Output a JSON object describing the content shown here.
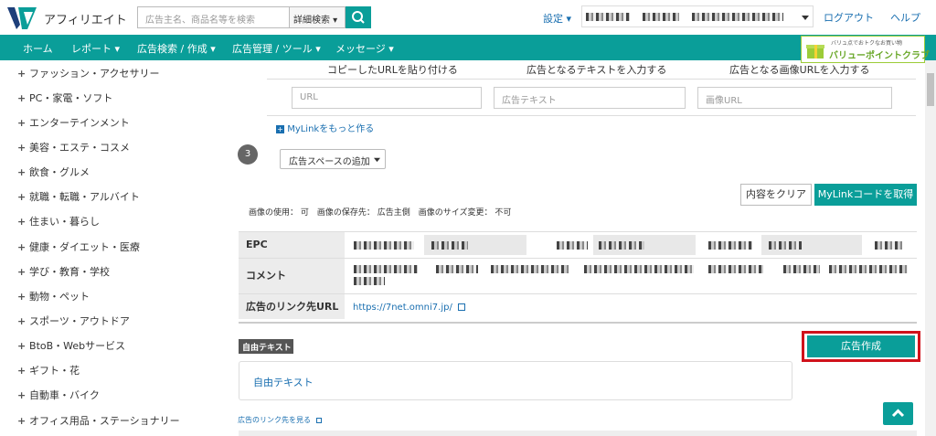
{
  "header": {
    "logo_text": "アフィリエイト",
    "search_placeholder": "広告主名、商品名等を検索",
    "detail_search_label": "詳細検索 ▾",
    "settings_label": "設定 ▾",
    "logout_label": "ログアウト",
    "help_label": "ヘルプ"
  },
  "nav": {
    "items": [
      "ホーム",
      "レポート ▾",
      "広告検索 / 作成 ▾",
      "広告管理 / ツール ▾",
      "メッセージ ▾"
    ],
    "banner_small": "バリュ点でおトクなお買い物",
    "banner_main": "バリューポイントクラブ"
  },
  "sidebar": {
    "items": [
      "ファッション・アクセサリー",
      "PC・家電・ソフト",
      "エンターテインメント",
      "美容・エステ・コスメ",
      "飲食・グルメ",
      "就職・転職・アルバイト",
      "住まい・暮らし",
      "健康・ダイエット・医療",
      "学び・教育・学校",
      "動物・ペット",
      "スポーツ・アウトドア",
      "BtoB・Webサービス",
      "ギフト・花",
      "自動車・バイク",
      "オフィス用品・ステーショナリー"
    ]
  },
  "mylink": {
    "col1_head": "コピーしたURLを貼り付ける",
    "col2_head": "広告となるテキストを入力する",
    "col3_head": "広告となる画像URLを入力する",
    "url_placeholder": "URL",
    "text_placeholder": "広告テキスト",
    "image_placeholder": "画像URL",
    "more_link": "MyLinkをもっと作る",
    "step_number": "3",
    "space_select": "広告スペースの追加",
    "clear_button": "内容をクリア",
    "get_code_button": "MyLinkコードを取得"
  },
  "info": {
    "usage": "画像の使用： 可　画像の保存先： 広告主側　画像のサイズ変更： 不可"
  },
  "table": {
    "epc_label": "EPC",
    "comment_label": "コメント",
    "link_label": "広告のリンク先URL",
    "link_value": "https://7net.omni7.jp/"
  },
  "free_text": {
    "tag": "自由テキスト",
    "create_button": "広告作成",
    "box_text": "自由テキスト",
    "see_link": "広告のリンク先を見る"
  },
  "colors": {
    "brand_teal": "#0a9e99",
    "link_blue": "#1a6fb0",
    "highlight_red": "#d0121b"
  }
}
